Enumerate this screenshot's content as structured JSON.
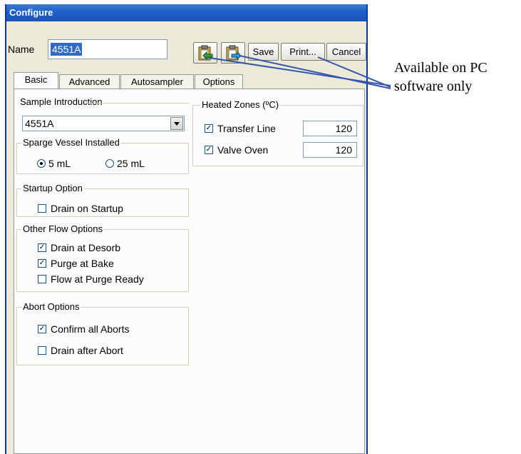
{
  "window": {
    "title": "Configure"
  },
  "name_label": "Name",
  "name_value": "4551A",
  "toolbar": {
    "save": "Save",
    "print": "Print...",
    "cancel": "Cancel"
  },
  "tabs": [
    {
      "label": "Basic",
      "active": true
    },
    {
      "label": "Advanced",
      "active": false
    },
    {
      "label": "Autosampler",
      "active": false
    },
    {
      "label": "Options",
      "active": false
    }
  ],
  "sample_introduction": {
    "title": "Sample Introduction",
    "selected": "4551A"
  },
  "sparge_vessel": {
    "title": "Sparge Vessel Installed",
    "option1": "5 mL",
    "option2": "25 mL",
    "selected": "5 mL"
  },
  "startup_option": {
    "title": "Startup Option",
    "drain_on_startup": {
      "label": "Drain on Startup",
      "checked": false
    }
  },
  "other_flow": {
    "title": "Other Flow Options",
    "items": [
      {
        "label": "Drain at Desorb",
        "checked": true
      },
      {
        "label": "Purge at Bake",
        "checked": true
      },
      {
        "label": "Flow at Purge Ready",
        "checked": false
      }
    ]
  },
  "abort_options": {
    "title": "Abort Options",
    "items": [
      {
        "label": "Confirm all Aborts",
        "checked": true
      },
      {
        "label": "Drain after Abort",
        "checked": false
      }
    ]
  },
  "heated_zones": {
    "title": "Heated Zones (ºC)",
    "transfer_line": {
      "label": "Transfer Line",
      "checked": true,
      "value": "120"
    },
    "valve_oven": {
      "label": "Valve Oven",
      "checked": true,
      "value": "120"
    }
  },
  "annotation": {
    "line1": "Available on PC",
    "line2": "software only"
  },
  "colors": {
    "title_bar": "#1f5fc6",
    "annotation_arrow": "#3355aa",
    "selection": "#316ac5"
  }
}
